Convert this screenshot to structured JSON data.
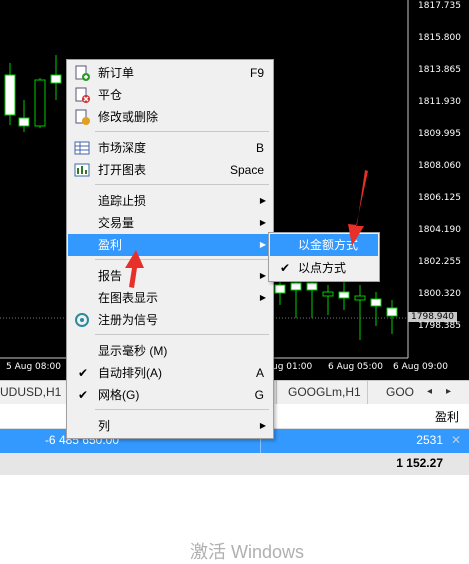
{
  "chart": {
    "prices": [
      "1817.735",
      "1815.800",
      "1813.865",
      "1811.930",
      "1809.995",
      "1808.060",
      "1806.125",
      "1804.190",
      "1802.255",
      "1800.320",
      "1798.385"
    ],
    "highlighted_price": "1798.940",
    "time_labels": [
      "5 Aug 08:00",
      "ug 01:00",
      "6 Aug 05:00",
      "6 Aug 09:00"
    ]
  },
  "tabs": {
    "items": [
      "UDUSD,H1",
      "GOOGLm,H1",
      "GOO"
    ],
    "left_arrow": "◂",
    "right_arrow": "▸"
  },
  "grid": {
    "header_profit": "盈利",
    "row": {
      "volume": "-6 485 650.00",
      "profit": "2531",
      "close": "✕"
    },
    "total": "1 152.27"
  },
  "watermark": "激活 Windows",
  "menu": {
    "new_order": {
      "label": "新订单",
      "shortcut": "F9",
      "icon": "new-order-icon"
    },
    "close_position": {
      "label": "平仓",
      "icon": "close-position-icon"
    },
    "modify_delete": {
      "label": "修改或删除",
      "icon": "modify-icon"
    },
    "market_depth": {
      "label": "市场深度",
      "shortcut": "B",
      "icon": "market-depth-icon"
    },
    "open_chart": {
      "label": "打开图表",
      "shortcut": "Space",
      "icon": "chart-icon"
    },
    "trailing_stop": {
      "label": "追踪止损"
    },
    "volume": {
      "label": "交易量"
    },
    "profit": {
      "label": "盈利"
    },
    "report": {
      "label": "报告"
    },
    "show_on_chart": {
      "label": "在图表显示"
    },
    "register_signal": {
      "label": "注册为信号",
      "icon": "signal-icon"
    },
    "show_ms": {
      "label": "显示毫秒 (M)"
    },
    "auto_arrange": {
      "label": "自动排列(A)",
      "shortcut": "A"
    },
    "grid": {
      "label": "网格(G)",
      "shortcut": "G"
    },
    "columns": {
      "label": "列"
    }
  },
  "submenu": {
    "by_amount": {
      "label": "以金额方式"
    },
    "by_points": {
      "label": "以点方式"
    }
  },
  "colors": {
    "accent": "#3399ff",
    "annotation": "#e8302a",
    "bull": "#ffffff",
    "wick": "#00cc00"
  }
}
